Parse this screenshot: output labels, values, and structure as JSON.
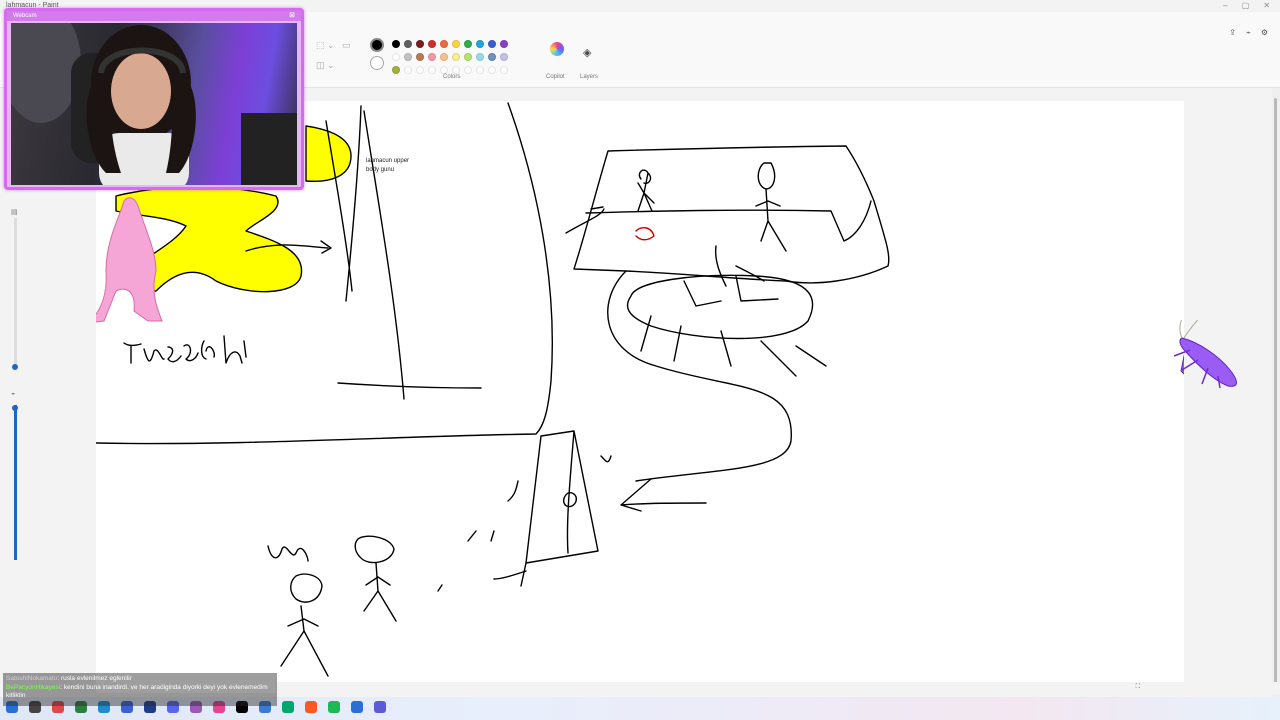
{
  "window": {
    "title": "lahmacun - Paint"
  },
  "ribbon": {
    "groups": {
      "colors_label": "Colors",
      "copilot_label": "Copilot",
      "layers_label": "Layers"
    },
    "palette": [
      "#000000",
      "#5f5f5f",
      "#7a1d1d",
      "#d12d2d",
      "#f0683b",
      "#fbd33d",
      "#2fad4a",
      "#1da7e0",
      "#3c5fd6",
      "#8a3fbf",
      "#ffffff",
      "#c3c3c3",
      "#b97a57",
      "#f29aa8",
      "#f6c28b",
      "#f8ef8f",
      "#b5e46a",
      "#99d9ea",
      "#7092be",
      "#c8bfe7",
      "#a3b03a",
      "#ffffff",
      "#ffffff",
      "#ffffff",
      "#ffffff",
      "#ffffff",
      "#ffffff",
      "#ffffff",
      "#ffffff",
      "#ffffff"
    ],
    "primary_color": "#000000",
    "secondary_color": "#ffffff"
  },
  "canvas": {
    "note_text": "lahmacun upper\nbody gunu",
    "handwriting": "TRICeps he"
  },
  "webcam": {
    "label": "Webcam"
  },
  "chat": [
    {
      "user": "SatoshiNokamato",
      "message": "rusla evlenilmez eglenilir"
    },
    {
      "user": "BePacyonHikayesi",
      "message": "kendini buna inandirdi. ve her aradiginda diyorki deyi yok evlenemedim kitliktin"
    }
  ]
}
